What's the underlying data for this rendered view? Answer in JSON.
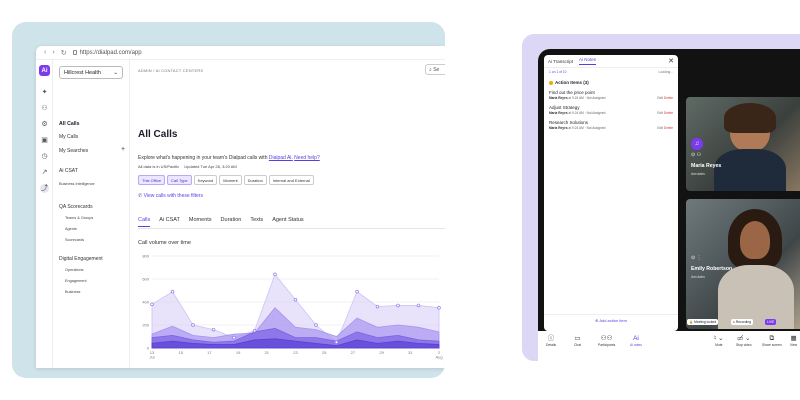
{
  "browser": {
    "url": "https://dialpad.com/app"
  },
  "app": {
    "logo": "Ai",
    "org_select": "Hillcrest Health",
    "breadcrumb": "ADMIN / AI CONTACT CENTERS",
    "search_label": "Se",
    "sidebar": {
      "all_calls": "All Calls",
      "my_calls": "My Calls",
      "my_searches": "My Searches",
      "ai_csat": "Ai CSAT",
      "business_intelligence": "Business Intelligence",
      "qa_scorecards": "QA Scorecards",
      "qa_items": [
        "Teams & Groups",
        "Agents",
        "Scorecards"
      ],
      "digital_engagement": "Digital Engagement",
      "de_items": [
        "Operations",
        "Engagement",
        "Business"
      ]
    },
    "page_title": "All Calls",
    "subtitle": "Explore what's happening in your team's Dialpad calls with",
    "subtitle_link1": "Dialpad Ai.",
    "subtitle_link2": "Need help?",
    "meta_tz": "All data is in US/Pacific",
    "meta_updated": "Updated Tue Apr 28, 3:20 AM",
    "filters": [
      "This Office",
      "Call Type",
      "Keyword",
      "Moment",
      "Duration",
      "Internal and External"
    ],
    "view_calls": "View calls with these filters",
    "tabs": [
      "Calls",
      "Ai CSAT",
      "Moments",
      "Duration",
      "Texts",
      "Agent Status"
    ],
    "chart_title": "Call volume over time"
  },
  "chart_data": {
    "type": "area",
    "title": "Call volume over time",
    "xlabel": "",
    "ylabel": "",
    "x_tick_labels": [
      "13\nJul",
      "15",
      "17",
      "19",
      "21",
      "23",
      "25",
      "27",
      "29",
      "31",
      "2\nAug"
    ],
    "y_tick_labels": [
      "0",
      "200",
      "400",
      "600",
      "800"
    ],
    "ylim": [
      0,
      800
    ],
    "series": [
      {
        "values": [
          380,
          490,
          200,
          160,
          90,
          150,
          640,
          420,
          200,
          50,
          490,
          360,
          370,
          370,
          350
        ]
      },
      {
        "values": [
          120,
          190,
          110,
          90,
          120,
          130,
          350,
          180,
          160,
          100,
          260,
          180,
          200,
          180,
          140
        ]
      },
      {
        "values": [
          90,
          110,
          70,
          50,
          60,
          140,
          170,
          90,
          90,
          60,
          140,
          90,
          110,
          70,
          60
        ]
      },
      {
        "values": [
          40,
          60,
          40,
          30,
          30,
          70,
          80,
          60,
          40,
          20,
          70,
          40,
          60,
          40,
          30
        ]
      }
    ],
    "grid": true,
    "colors": [
      "#cdc2f7",
      "#a894f0",
      "#7b62e4",
      "#5a3fd3"
    ]
  },
  "ai_panel": {
    "tab_transcript": "Ai Transcript",
    "tab_notes": "Ai Notes",
    "meta_left": "1 on 1 of 10",
    "meta_right": "Loading...",
    "section": "Action Items (3)",
    "items": [
      {
        "title": "Find out the price point",
        "who": "Maria Reyes",
        "time": "at 9:24 AM",
        "status": "Not Assigned"
      },
      {
        "title": "Adjust Strategy",
        "who": "Maria Reyes",
        "time": "at 9:24 AM",
        "status": "Not Assigned"
      },
      {
        "title": "Research Solutions",
        "who": "Maria Reyes",
        "time": "at 9:24 AM",
        "status": "Not Assigned"
      }
    ],
    "edit_label": "Edit",
    "delete_label": "Delete",
    "add_action": "Add action item"
  },
  "participants": [
    {
      "name": "Maria Reyes",
      "org": "Aerolabs"
    },
    {
      "name": "Emily Robertson",
      "org": "Aerolabs"
    }
  ],
  "badges": {
    "meeting_locked": "Meeting locked",
    "recording": "Recording",
    "live": "LIVE"
  },
  "bottom_bar": [
    "Details",
    "Chat",
    "Participants",
    "Ai notes",
    "Mute",
    "Stop video",
    "Share screen",
    "View"
  ]
}
